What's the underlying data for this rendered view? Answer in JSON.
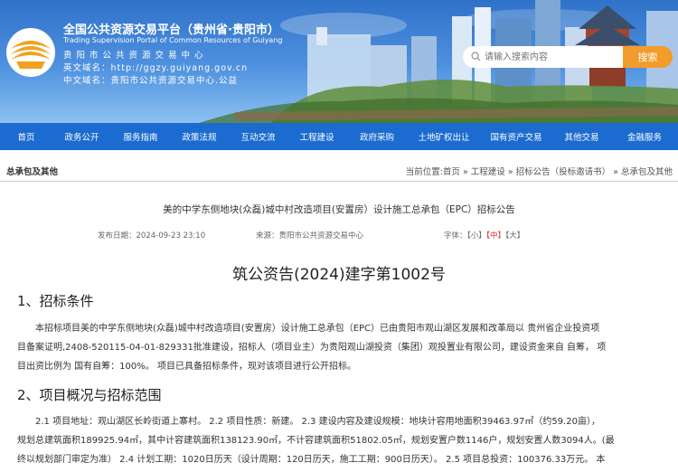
{
  "header": {
    "title": "全国公共资源交易平台（贵州省·贵阳市）",
    "en_title": "Trading Supervision Portal of Common Resources of Guiyang",
    "cn_subtitle": "贵阳市公共资源交易中心",
    "en_domain_label": "英文域名：",
    "en_domain_value": "http://ggzy.guiyang.gov.cn",
    "cn_domain_label": "中文域名：",
    "cn_domain_value": "贵阳市公共资源交易中心.公益"
  },
  "search": {
    "placeholder": "请输入搜索内容",
    "button_label": "搜索"
  },
  "nav": [
    "首页",
    "政务公开",
    "服务指南",
    "政策法规",
    "互动交流",
    "工程建设",
    "政府采购",
    "土地矿权出让",
    "国有资产交易",
    "其他交易",
    "金融服务"
  ],
  "section_title": "总承包及其他",
  "breadcrumb": "当前位置:首页 » 工程建设 » 招标公告（投标邀请书） » 总承包及其他",
  "article": {
    "heading": "美的中学东侧地块(众磊)城中村改造项目(安置房）设计施工总承包（EPC）招标公告",
    "publish_date": "发布日期：2024-09-23 23:10",
    "source": "来源：贵阳市公共资源交易中心",
    "font_label": "字体：",
    "font_small": "【小】",
    "font_medium": "【中】",
    "font_large": "【大】",
    "doc_number": "筑公资告(2024)建字第1002号",
    "section1_title": "1、招标条件",
    "section1_line1": "本招标项目美的中学东侧地块(众磊)城中村改造项目(安置房）设计施工总承包（EPC）已由贵阳市观山湖区发展和改革局以 贵州省企业投资项",
    "section1_line2": "目备案证明,2408-520115-04-01-829331批准建设，招标人（项目业主）为贵阳观山湖投资（集团）观投置业有限公司，建设资金来自 自筹， 项",
    "section1_line3": "目出资比例为 国有自筹：100%。 项目已具备招标条件，现对该项目进行公开招标。",
    "section2_title": "2、项目概况与招标范围",
    "section2_line1": "2.1 项目地址：观山湖区长岭街道上寨村。 2.2 项目性质：新建。 2.3 建设内容及建设规模：地块计容用地面积39463.97㎡（约59.20亩），",
    "section2_line2": "规划总建筑面积189925.94㎡，其中计容建筑面积138123.90㎡，不计容建筑面积51802.05㎡，规划安置户数1146户，规划安置人数3094人。(最",
    "section2_line3": "终以规划部门审定为准） 2.4 计划工期：1020日历天（设计周期：120日历天，施工工期：900日历天）。 2.5 项目总投资：100376.33万元。 本"
  },
  "colors": {
    "nav_bg": "#1b6bd0",
    "search_button": "#f39c2b",
    "header_bg": "#3b80d6",
    "highlight_red": "#dd3333"
  }
}
